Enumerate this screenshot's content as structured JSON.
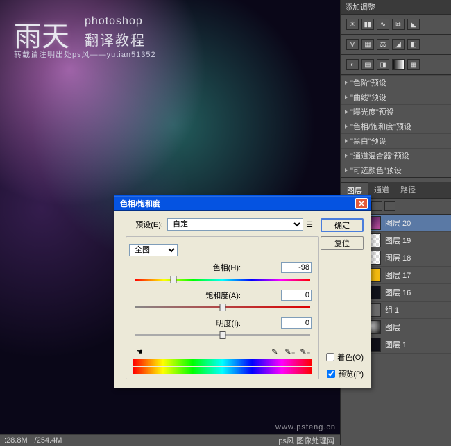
{
  "watermark": {
    "main": "雨天",
    "line1": "photoshop",
    "line2": "翻译教程",
    "credit": "转载请注明出处ps风——yutian51352",
    "site": "www.psfeng.cn"
  },
  "statusbar": {
    "zoom": "28.8M",
    "size": "254.4M"
  },
  "adjustments": {
    "title": "添加调整",
    "presets": [
      "\"色阶\"预设",
      "\"曲线\"预设",
      "\"曝光度\"预设",
      "\"色相/饱和度\"预设",
      "\"黑白\"预设",
      "\"通道混合器\"预设",
      "\"可选颜色\"预设"
    ]
  },
  "layerTabs": {
    "t1": "图层",
    "t2": "通道",
    "t3": "路径"
  },
  "layers": [
    {
      "name": "图层 20",
      "sel": true,
      "thumb": "linear-gradient(135deg,#2a1040,#c050a0)"
    },
    {
      "name": "图层 19",
      "thumb": "repeating-conic-gradient(#fff 0 25%,#ddd 0 50%) 0/8px 8px"
    },
    {
      "name": "图层 18",
      "thumb": "repeating-conic-gradient(#fff 0 25%,#ddd 0 50%) 0/8px 8px"
    },
    {
      "name": "图层 17",
      "thumb": "#f2b90f"
    },
    {
      "name": "图层 16",
      "thumb": "#11131b"
    },
    {
      "name": "组 1",
      "thumb": "#6b6b6b",
      "group": true
    },
    {
      "name": "图层",
      "thumb": "radial-gradient(circle at 40% 40%,#ddd,#111)"
    },
    {
      "name": "图层 1",
      "thumb": "#101018"
    }
  ],
  "dialog": {
    "title": "色相/饱和度",
    "presetLabel": "预设(E):",
    "presetValue": "自定",
    "editValue": "全图",
    "ok": "确定",
    "cancel": "复位",
    "hueLabel": "色相(H):",
    "hueValue": "-98",
    "satLabel": "饱和度(A):",
    "satValue": "0",
    "lightLabel": "明度(I):",
    "lightValue": "0",
    "colorize": "着色(O)",
    "preview": "预览(P)"
  },
  "footer": "ps风 图像处理网"
}
